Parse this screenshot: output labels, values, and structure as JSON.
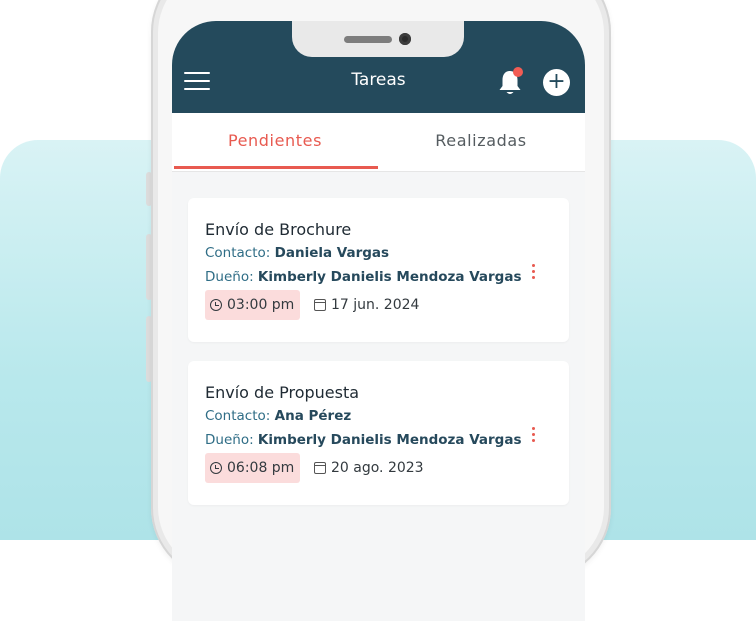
{
  "appbar": {
    "title": "Tareas",
    "menu_icon": "hamburger-menu-icon",
    "bell_icon": "bell-icon",
    "add_icon": "plus-icon",
    "add_label": "+"
  },
  "tabs": [
    {
      "label": "Pendientes",
      "active": true
    },
    {
      "label": "Realizadas",
      "active": false
    }
  ],
  "tasks": [
    {
      "title": "Envío de Brochure",
      "contact_label": "Contacto:",
      "contact": "Daniela Vargas",
      "owner_label": "Dueño:",
      "owner": "Kimberly Danielis Mendoza Vargas",
      "time": "03:00 pm",
      "date": "17 jun. 2024"
    },
    {
      "title": "Envío de Propuesta",
      "contact_label": "Contacto:",
      "contact": "Ana Pérez",
      "owner_label": "Dueño:",
      "owner": "Kimberly Danielis Mendoza Vargas",
      "time": "06:08 pm",
      "date": "20 ago. 2023"
    }
  ],
  "colors": {
    "appbar": "#244a5c",
    "accent": "#e85a50",
    "chip_bg": "#fbdcdc",
    "background": "#b8e8ec"
  }
}
